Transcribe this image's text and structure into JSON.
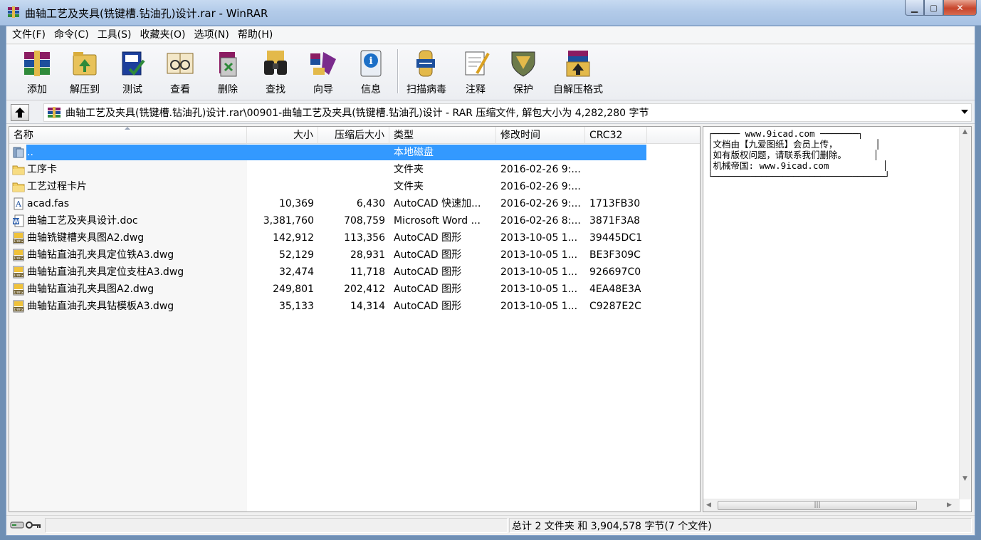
{
  "window": {
    "title": "曲轴工艺及夹具(铣键槽.钻油孔)设计.rar - WinRAR"
  },
  "menu": [
    "文件(F)",
    "命令(C)",
    "工具(S)",
    "收藏夹(O)",
    "选项(N)",
    "帮助(H)"
  ],
  "toolbar": [
    {
      "label": "添加",
      "icon": "add-archive-icon"
    },
    {
      "label": "解压到",
      "icon": "extract-to-icon"
    },
    {
      "label": "测试",
      "icon": "test-icon"
    },
    {
      "label": "查看",
      "icon": "view-icon"
    },
    {
      "label": "删除",
      "icon": "delete-icon"
    },
    {
      "label": "查找",
      "icon": "find-binoculars-icon"
    },
    {
      "label": "向导",
      "icon": "wizard-icon"
    },
    {
      "label": "信息",
      "icon": "info-icon"
    },
    {
      "label": "扫描病毒",
      "icon": "scan-virus-icon"
    },
    {
      "label": "注释",
      "icon": "comment-icon"
    },
    {
      "label": "保护",
      "icon": "protect-shield-icon"
    },
    {
      "label": "自解压格式",
      "icon": "sfx-icon"
    }
  ],
  "address": {
    "path": "曲轴工艺及夹具(铣键槽.钻油孔)设计.rar\\00901-曲轴工艺及夹具(铣键槽.钻油孔)设计 - RAR 压缩文件, 解包大小为 4,282,280 字节"
  },
  "columns": {
    "name": "名称",
    "size": "大小",
    "packed": "压缩后大小",
    "type": "类型",
    "modified": "修改时间",
    "crc": "CRC32"
  },
  "files": [
    {
      "name": "..",
      "size": "",
      "packed": "",
      "type": "本地磁盘",
      "modified": "",
      "crc": "",
      "icon": "parent-folder-icon",
      "selected": true
    },
    {
      "name": "工序卡",
      "size": "",
      "packed": "",
      "type": "文件夹",
      "modified": "2016-02-26 9:...",
      "crc": "",
      "icon": "folder-icon"
    },
    {
      "name": "工艺过程卡片",
      "size": "",
      "packed": "",
      "type": "文件夹",
      "modified": "2016-02-26 9:...",
      "crc": "",
      "icon": "folder-icon"
    },
    {
      "name": "acad.fas",
      "size": "10,369",
      "packed": "6,430",
      "type": "AutoCAD 快速加...",
      "modified": "2016-02-26 9:...",
      "crc": "1713FB30",
      "icon": "fas-file-icon"
    },
    {
      "name": "曲轴工艺及夹具设计.doc",
      "size": "3,381,760",
      "packed": "708,759",
      "type": "Microsoft Word ...",
      "modified": "2016-02-26 8:...",
      "crc": "3871F3A8",
      "icon": "word-doc-icon"
    },
    {
      "name": "曲轴铣键槽夹具图A2.dwg",
      "size": "142,912",
      "packed": "113,356",
      "type": "AutoCAD 图形",
      "modified": "2013-10-05 1...",
      "crc": "39445DC1",
      "icon": "dwg-file-icon"
    },
    {
      "name": "曲轴钻直油孔夹具定位铁A3.dwg",
      "size": "52,129",
      "packed": "28,931",
      "type": "AutoCAD 图形",
      "modified": "2013-10-05 1...",
      "crc": "BE3F309C",
      "icon": "dwg-file-icon"
    },
    {
      "name": "曲轴钻直油孔夹具定位支柱A3.dwg",
      "size": "32,474",
      "packed": "11,718",
      "type": "AutoCAD 图形",
      "modified": "2013-10-05 1...",
      "crc": "926697C0",
      "icon": "dwg-file-icon"
    },
    {
      "name": "曲轴钻直油孔夹具图A2.dwg",
      "size": "249,801",
      "packed": "202,412",
      "type": "AutoCAD 图形",
      "modified": "2013-10-05 1...",
      "crc": "4EA48E3A",
      "icon": "dwg-file-icon"
    },
    {
      "name": "曲轴钻直油孔夹具钻模板A3.dwg",
      "size": "35,133",
      "packed": "14,314",
      "type": "AutoCAD 图形",
      "modified": "2013-10-05 1...",
      "crc": "C9287E2C",
      "icon": "dwg-file-icon"
    }
  ],
  "comment": {
    "text": "┌───── www.9icad.com ───────┐\n│文档由【九爱图纸】会员上传，       │\n│如有版权问题，请联系我们删除。     │\n│机械帝国: www.9icad.com          │\n└────────────────────────────────┘"
  },
  "status": {
    "text": "总计 2 文件夹 和 3,904,578 字节(7 个文件)"
  },
  "colors": {
    "selection": "#3399ff",
    "titlebar": "#b3cbe9"
  }
}
